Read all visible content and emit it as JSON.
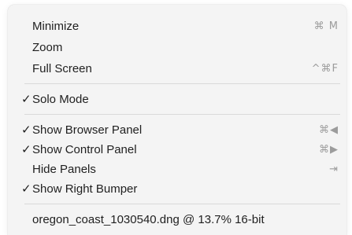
{
  "menu": {
    "items": [
      {
        "label": "Minimize",
        "checked": "",
        "shortcut": "⌘ M"
      },
      {
        "label": "Zoom",
        "checked": "",
        "shortcut": ""
      },
      {
        "label": "Full Screen",
        "checked": "",
        "shortcut": "^⌘F"
      },
      {
        "label": "Solo Mode",
        "checked": "✓",
        "shortcut": ""
      },
      {
        "label": "Show Browser Panel",
        "checked": "✓",
        "shortcut": "⌘◀"
      },
      {
        "label": "Show Control Panel",
        "checked": "✓",
        "shortcut": "⌘▶"
      },
      {
        "label": "Hide Panels",
        "checked": "",
        "shortcut": "⇥"
      },
      {
        "label": "Show Right Bumper",
        "checked": "✓",
        "shortcut": ""
      },
      {
        "label": "oregon_coast_1030540.dng @ 13.7% 16-bit",
        "checked": "",
        "shortcut": ""
      }
    ]
  },
  "colors": {
    "background": "#f4f4f4",
    "text": "#1f1f1f",
    "shortcut": "#9c9c9c",
    "separator": "#d9d9d9"
  }
}
